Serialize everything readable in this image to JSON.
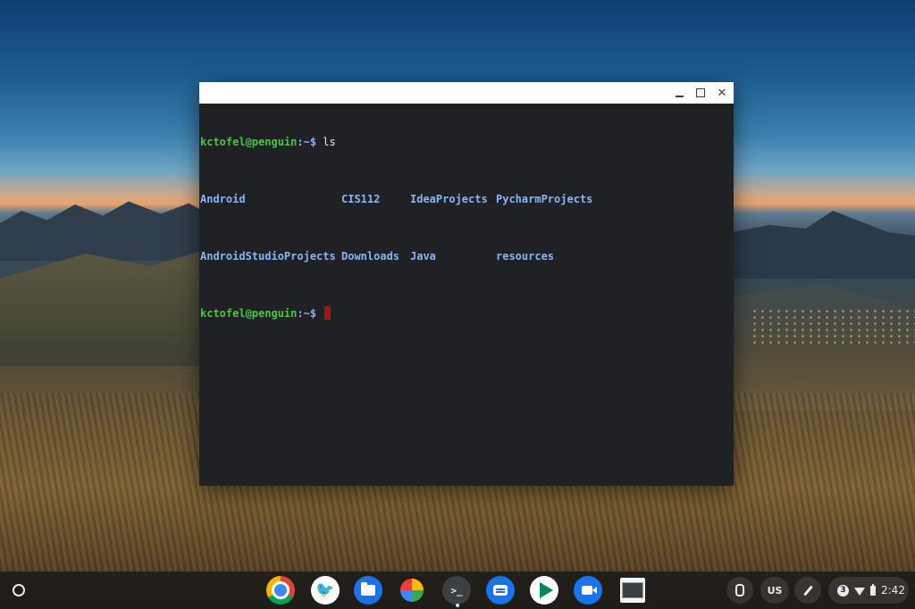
{
  "terminal": {
    "lines": [
      {
        "user": "kctofel@penguin",
        "path": ":~$ ",
        "command": "ls"
      },
      {
        "entries": [
          "Android",
          "CIS112",
          "IdeaProjects",
          "PycharmProjects"
        ]
      },
      {
        "entries": [
          "AndroidStudioProjects",
          "Downloads",
          "Java",
          "resources"
        ]
      },
      {
        "user": "kctofel@penguin",
        "path": ":~$ ",
        "command": ""
      }
    ]
  },
  "window_controls": {
    "minimize_icon": "minimize-icon",
    "maximize_icon": "maximize-icon",
    "close_icon": "close-icon",
    "close_glyph": "✕"
  },
  "shelf": {
    "apps": [
      {
        "name": "chrome",
        "icon": "chrome-icon"
      },
      {
        "name": "twitter",
        "icon": "twitter-bird-icon",
        "glyph": "🐦"
      },
      {
        "name": "files",
        "icon": "folder-icon"
      },
      {
        "name": "photos",
        "icon": "pinwheel-icon"
      },
      {
        "name": "terminal",
        "icon": "terminal-icon",
        "glyph": ">_"
      },
      {
        "name": "messages",
        "icon": "message-icon"
      },
      {
        "name": "play-store",
        "icon": "play-store-icon"
      },
      {
        "name": "duo",
        "icon": "video-camera-icon"
      },
      {
        "name": "window-thumbnail",
        "icon": "window-icon"
      }
    ],
    "tray": {
      "ime": "US",
      "notification_count": "3",
      "time": "2:42"
    }
  },
  "colors": {
    "prompt_user": "#4bc73f",
    "prompt_path": "#8ab4f8",
    "directory": "#8ab4f8",
    "cursor": "#a3151d",
    "terminal_bg": "#202124"
  }
}
